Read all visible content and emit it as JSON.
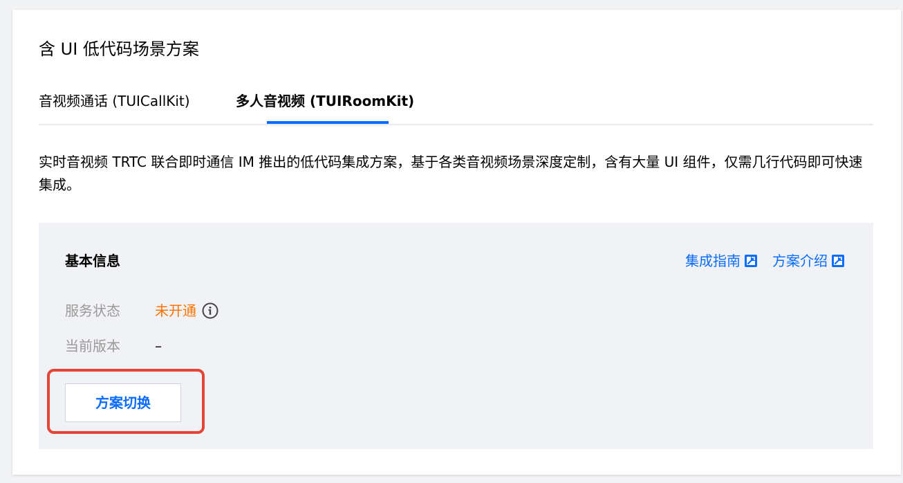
{
  "section_title": "含 UI 低代码场景方案",
  "tabs": [
    {
      "label": "音视频通话 (TUICallKit)",
      "active": false
    },
    {
      "label": "多人音视频 (TUIRoomKit)",
      "active": true
    }
  ],
  "description": "实时音视频 TRTC 联合即时通信 IM 推出的低代码集成方案，基于各类音视频场景深度定制，含有大量 UI 组件，仅需几行代码即可快速集成。",
  "info": {
    "title": "基本信息",
    "links": [
      {
        "label": "集成指南",
        "icon": "external-link-icon"
      },
      {
        "label": "方案介绍",
        "icon": "external-link-icon"
      }
    ],
    "status": {
      "label": "服务状态",
      "value": "未开通",
      "icon": "info-icon"
    },
    "version": {
      "label": "当前版本",
      "value": "–"
    },
    "switch_button": "方案切换"
  },
  "colors": {
    "accent": "#0a6cff",
    "status_warning": "#ff7200",
    "highlight": "#e54535"
  }
}
